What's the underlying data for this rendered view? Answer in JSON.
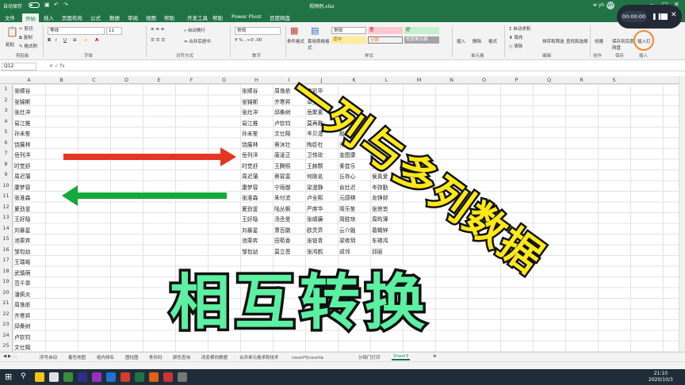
{
  "titlebar": {
    "autosave": "自动保存",
    "filename": "视频例.xlsx",
    "user": "w yh",
    "avatar": "WY"
  },
  "tabs": [
    "文件",
    "开始",
    "插入",
    "页面布局",
    "公式",
    "数据",
    "审阅",
    "视图",
    "帮助",
    "开发工具",
    "帮助",
    "Power Pivot",
    "百度网盘"
  ],
  "active_tab": "开始",
  "ribbon": {
    "clipboard": {
      "paste": "粘贴",
      "cut": "剪切",
      "copy": "复制",
      "format_painter": "格式刷",
      "group": "剪贴板"
    },
    "font": {
      "name": "等线",
      "size": "11",
      "group": "字体"
    },
    "align": {
      "wrap": "自动换行",
      "merge": "合并后居中",
      "group": "对齐方式"
    },
    "number": {
      "format": "常规",
      "group": "数字"
    },
    "styles": {
      "cond": "条件格式",
      "table": "套用表格格式",
      "normal": "常规",
      "bad": "差",
      "good": "好",
      "neutral": "适中",
      "calc": "计算",
      "check": "检查单元格",
      "group": "样式"
    },
    "cells": {
      "insert": "插入",
      "delete": "删除",
      "format": "格式",
      "group": "单元格"
    },
    "editing": {
      "autosum": "自动求和",
      "fill": "填充",
      "clear": "清除",
      "sort": "排序和筛选",
      "find": "查找和选择",
      "group": "编辑"
    },
    "share": {
      "create": "创建",
      "group": "创作"
    },
    "save": {
      "label": "保存到百度网盘",
      "group": "保存"
    },
    "insert_tab": {
      "label": "插入打",
      "group": "插入"
    }
  },
  "namebox": "Q12",
  "columns": [
    "A",
    "B",
    "C",
    "D",
    "E",
    "F",
    "G",
    "H",
    "I",
    "J",
    "K",
    "L",
    "M",
    "N",
    "O",
    "P",
    "Q",
    "R",
    "S"
  ],
  "rows": [
    "1",
    "2",
    "3",
    "4",
    "5",
    "6",
    "7",
    "8",
    "9",
    "10",
    "11",
    "12",
    "13",
    "14",
    "15",
    "16",
    "17",
    "18",
    "19",
    "20",
    "21",
    "22",
    "23",
    "24",
    "25"
  ],
  "colA": [
    "张顺谷",
    "张锦斯",
    "张灶冲",
    "易江推",
    "孙未笙",
    "饶展林",
    "岳列洋",
    "时觉舒",
    "周迟蒲",
    "康梦容",
    "张淮森",
    "夏劲釜",
    "王好隐",
    "刘暴星",
    "池栗弈",
    "邹包幼",
    "王瑞峪",
    "武慎萌",
    "范千章",
    "潘佩炎",
    "周逸依",
    "齐寒昇",
    "邱桑树",
    "卢钦钧",
    "文仕翔"
  ],
  "colH": [
    "张顺谷",
    "张锦斯",
    "张灶冲",
    "易江推",
    "孙未笙",
    "饶展林",
    "岳列洋",
    "时觉舒",
    "周迟蒲",
    "康梦容",
    "张淮森",
    "夏劲釜",
    "王好隐",
    "刘暴星",
    "池栗弈",
    "邹包幼"
  ],
  "colI": [
    "周逸依",
    "齐寒昇",
    "邱桑树",
    "卢钦钧",
    "文仕翔",
    "蔡沐壮",
    "唐凌正",
    "王腾照",
    "蔡容富",
    "宁雨御",
    "朱付流",
    "陆丛枫",
    "汤丞旻",
    "萧百徽",
    "田荀香",
    "莫立恩"
  ],
  "colJ": [
    "李彩华",
    "卓互知",
    "岳聚素",
    "莫再歌",
    "岑贝澄",
    "陶臣杜",
    "卫恃玫",
    "王赫颢",
    "何刚名",
    "梁澄静",
    "卢全熙",
    "严席华",
    "张順廉",
    "欧灵弄",
    "张铂青",
    "张鸿鹤"
  ],
  "colK": [
    "",
    "",
    "",
    "",
    "殷菜毓",
    "齐聪冲",
    "金图康",
    "秦尝乐",
    "丘存心",
    "俞灶迟",
    "元感棋",
    "简乐笙",
    "简胜玦",
    "云介融",
    "梁夜玥",
    "成邻"
  ],
  "colL": [
    "",
    "",
    "",
    "",
    "",
    "",
    "严烈",
    "吴来枣",
    "侯真爱",
    "岑弥勤",
    "龙铮财",
    "张侠皆",
    "周昀薄",
    "葛糊锌",
    "车瑛鸿",
    "邱丽"
  ],
  "sheets": [
    "序号自动",
    "着色地图",
    "组内排名",
    "图柱图",
    "条形码",
    "颜色查询",
    "改变横向数据",
    "合并单元格求和技术",
    "count与counta",
    "分部门打印",
    "Sheet3"
  ],
  "active_sheet": "Sheet3",
  "taskbar": {
    "time": "21:10",
    "date": "2020/10/3"
  },
  "recorder": {
    "time": "00:00:00"
  },
  "overlay": {
    "line1": "一列与多列数据",
    "line2": "相互转换"
  },
  "colors": {
    "excel_green": "#217346",
    "red_arrow": "#e53624",
    "green_arrow": "#16a83a",
    "title_yellow": "#ffe818",
    "title_green": "#5cf0a2"
  }
}
